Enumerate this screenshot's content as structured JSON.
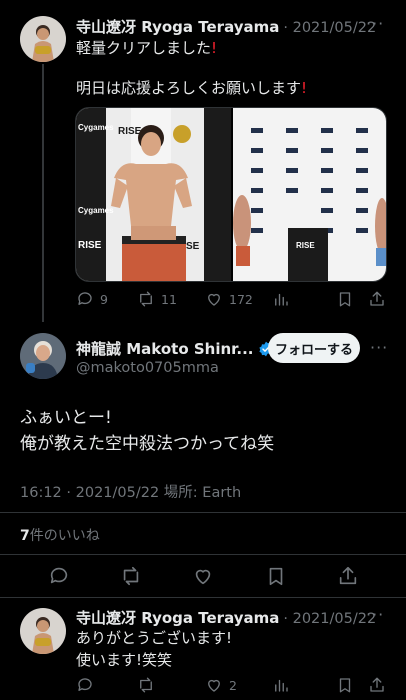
{
  "tweet1": {
    "name": "寺山遼冴 Ryoga Terayama",
    "date": "· 2021/05/22",
    "more": "···",
    "line1": "軽量クリアしました",
    "line2": "明日は応援よろしくお願いします",
    "exclaim": "!",
    "image_left_banners": [
      "Cygames",
      "RISE",
      "Cygames",
      "RISE",
      "RISE"
    ],
    "image_right_text": "RISE",
    "actions": {
      "replies": "9",
      "retweets": "11",
      "likes": "172"
    }
  },
  "tweet2": {
    "name": "神龍誠 Makoto Shinr...",
    "handle": "@makoto0705mma",
    "follow_label": "フォローする",
    "more": "···",
    "line1": "ふぁいとー!",
    "line2": "俺が教えた空中殺法つかってね笑",
    "timestamp": "16:12 · 2021/05/22 場所: Earth",
    "likes_count": "7",
    "likes_label": "件のいいね"
  },
  "tweet3": {
    "name": "寺山遼冴 Ryoga Terayama",
    "date": "· 2021/05/22",
    "more": "···",
    "line1": "ありがとうございます!",
    "line2": "使います!笑笑",
    "actions": {
      "likes": "2"
    }
  },
  "colors": {
    "verified": "#1d9bf0",
    "red": "#f4212e",
    "muted": "#71767b",
    "divider": "#2f3336"
  }
}
